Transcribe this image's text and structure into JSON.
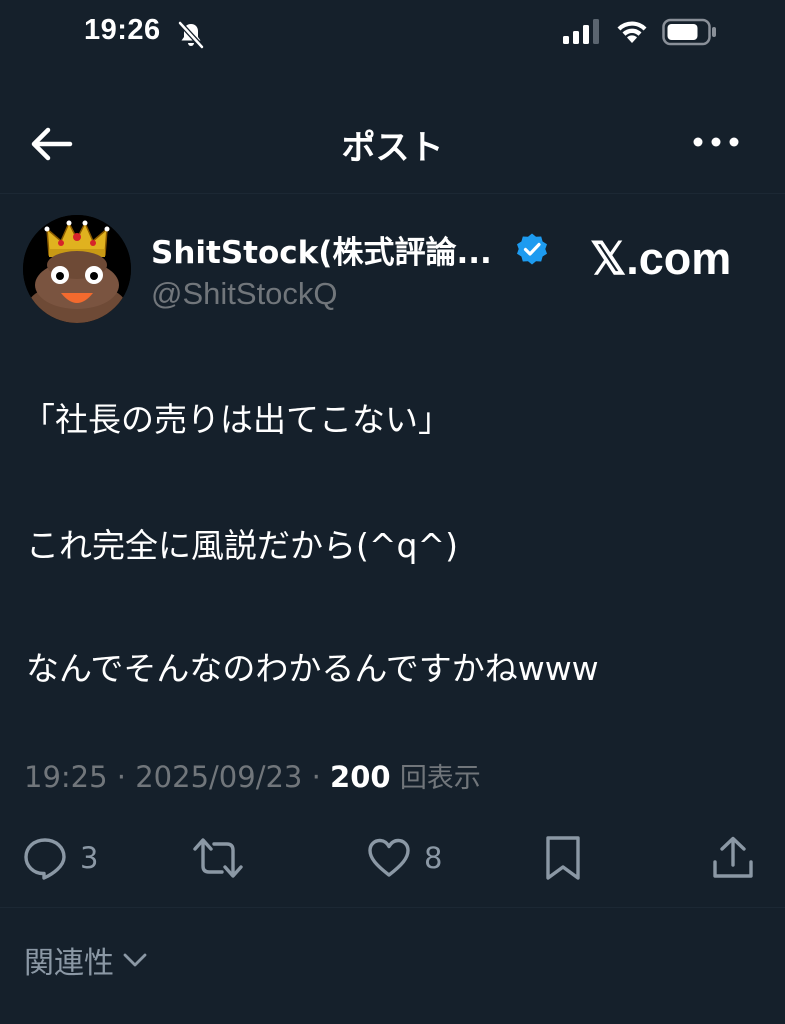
{
  "status_bar": {
    "time": "19:26",
    "icons": [
      "bell-off-icon",
      "signal-icon",
      "wifi-icon",
      "battery-icon"
    ]
  },
  "header": {
    "title": "ポスト",
    "back_icon": "arrow-left-icon",
    "more_icon": "more-horizontal-icon"
  },
  "author": {
    "name": "ShitStock(株式評論...",
    "handle": "@ShitStockQ",
    "verified": true,
    "avatar_icon": "crowned-poop-avatar"
  },
  "watermark": "𝕏.com",
  "tweet": {
    "lines": [
      "「社長の売りは出てこない」",
      "これ完全に風説だから(^q^)",
      "なんでそんなのわかるんですかねwww"
    ]
  },
  "meta": {
    "time": "19:25",
    "separator": "·",
    "date": "2025/09/23",
    "views_count": "200",
    "views_label": "回表示"
  },
  "actions": {
    "reply_count": "3",
    "repost_count": "",
    "like_count": "8",
    "icons": [
      "reply-icon",
      "repost-icon",
      "like-icon",
      "bookmark-icon",
      "share-icon"
    ]
  },
  "relevance": {
    "label": "関連性"
  },
  "colors": {
    "background": "#15202b",
    "text": "#ffffff",
    "muted": "#71767b",
    "verified": "#1d9bf0"
  }
}
